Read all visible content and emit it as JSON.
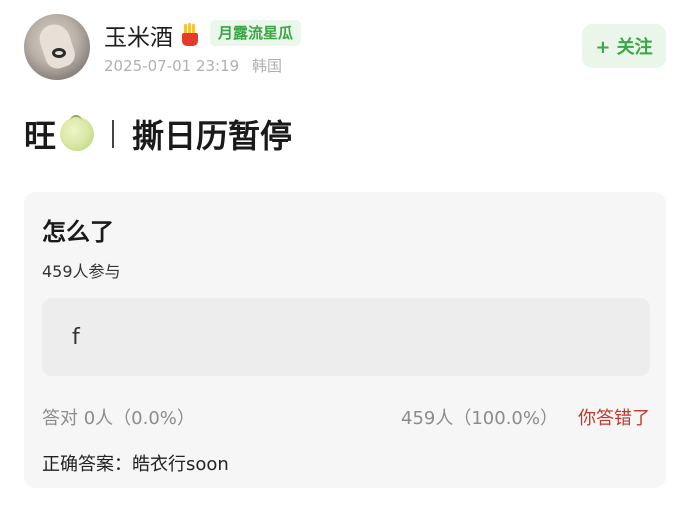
{
  "post": {
    "username": "玉米酒",
    "tag": "月露流星瓜",
    "date": "2025-07-01 23:19",
    "location": "韩国",
    "follow_label": "+ 关注",
    "title_left": "旺",
    "title_right": "撕日历暂停"
  },
  "quiz": {
    "question": "怎么了",
    "participants": "459人参与",
    "option": "f",
    "correct_stats": "答对  0人（0.0%）",
    "wrong_stats": "459人（100.0%）",
    "your_result": "你答错了",
    "answer_label": "正确答案：",
    "answer_value": "皓衣行soon"
  },
  "colors": {
    "accent_green": "#3aa645",
    "wrong_red": "#c0392b"
  }
}
